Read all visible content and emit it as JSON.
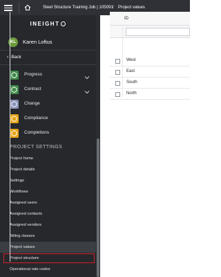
{
  "topbar": {
    "breadcrumb_job": "Steel Structure Training Job | 105091",
    "breadcrumb_sep": "/",
    "breadcrumb_page": "Project values"
  },
  "sidebar": {
    "logo": "INEIGHT",
    "user": {
      "initials": "KL",
      "name": "Karen Loftus"
    },
    "back_label": "Back",
    "modules": [
      {
        "label": "Progress",
        "color": "#3f8a4a",
        "expandable": true
      },
      {
        "label": "Contract",
        "color": "#3f8a4a",
        "expandable": true
      },
      {
        "label": "Change",
        "color": "#8a93b8",
        "expandable": false
      },
      {
        "label": "Compliance",
        "color": "#e6a417",
        "expandable": false
      },
      {
        "label": "Completions",
        "color": "#e6a417",
        "expandable": false
      }
    ],
    "section_title": "PROJECT SETTINGS",
    "settings_items": [
      "Project home",
      "Project details",
      "Settings",
      "Workflows",
      "Assigned users",
      "Assigned contacts",
      "Assigned vendors",
      "Billing classes",
      "Project values",
      "Project structure",
      "Operational rate codes"
    ],
    "active_item": "Project values",
    "highlighted_item": "Project structure"
  },
  "grid": {
    "column_header": "ID",
    "rows": [
      "West",
      "East",
      "South",
      "North"
    ]
  },
  "colors": {
    "topbar": "#2f3136",
    "sidebar": "#26282c",
    "accent": "#2a7ad6",
    "highlight": "#d8202a"
  }
}
